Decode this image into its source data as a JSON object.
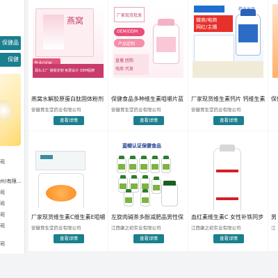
{
  "left_panel": {
    "buttons": [
      "保健品",
      "保健"
    ],
    "texts": [
      "司",
      "州)有限...",
      "司",
      "司",
      "司",
      "司",
      "司"
    ]
  },
  "cards": [
    {
      "title": "燕窝水解胶原蛋白肽固体粉剂",
      "company": "安徽育生堂药业有限公司",
      "button": "查看详情"
    },
    {
      "title": "保健食品多种维生素咀嚼片蓝",
      "company": "安徽育生堂药业有限公司",
      "button": "查看详情"
    },
    {
      "title": "厂家现货维生素钙片 钙维生素",
      "company": "安徽育生堂药业有限公司",
      "button": "查看详情"
    },
    {
      "title": "保健",
      "company": "",
      "button": ""
    },
    {
      "title": "厂家现货维生素C维生素E咀嚼",
      "company": "安徽育生堂药业有限公司",
      "button": "查看详情"
    },
    {
      "title": "左旋肉碱茶多酚减肥品男性保",
      "company": "江西康之初实业有限公司",
      "button": "查看详情"
    },
    {
      "title": "血红素维生素C 女性补铁同步",
      "company": "江西康之初实业有限公司",
      "button": "查看详情"
    },
    {
      "title": "男",
      "company": "江",
      "button": ""
    }
  ],
  "image_texts": {
    "card1": [
      "燕窝",
      "专业OEM",
      "源头工厂 接受定制 免费设计 OEM贴牌"
    ],
    "card2": [
      "厂家现货批发",
      "OEM/ODM",
      "产品定制",
      "包装设计",
      "直播 团购",
      "电商 代发",
      "样品免费"
    ],
    "card3": [
      "药业出品",
      "微商/电商",
      "网红/主播",
      "直播 团购",
      "平台 代发"
    ],
    "card6": [
      "蓝帽认证保健食品"
    ]
  }
}
